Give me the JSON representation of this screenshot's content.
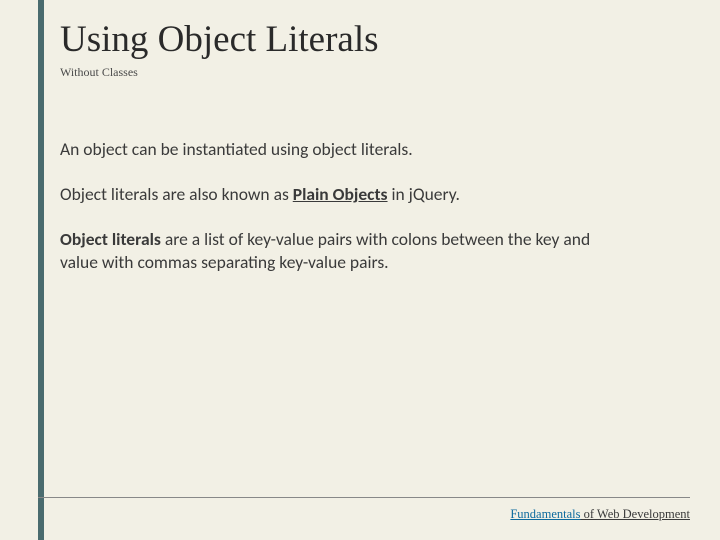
{
  "slide": {
    "title": "Using Object Literals",
    "subtitle": "Without Classes",
    "para1": "An object can be instantiated using object literals.",
    "para2_a": "Object literals are also known as ",
    "para2_bold": "Plain Objects",
    "para2_b": " in jQuery.",
    "para3_bold": "Object literals",
    "para3_rest": " are a list of key-value pairs with colons between the key and value with commas separating key-value pairs."
  },
  "footer": {
    "brand": "Fundamentals",
    "rest": " of Web Development"
  }
}
